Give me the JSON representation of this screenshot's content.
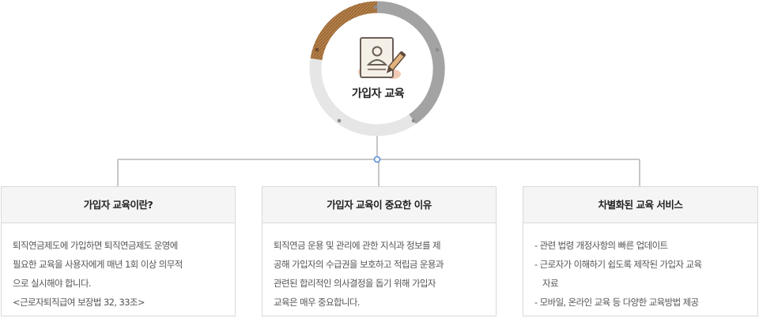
{
  "hub": {
    "label": "가입자 교육",
    "icon": "user-document-edit-icon",
    "ring_colors": {
      "track": "#e6e6e6",
      "shade": "#a3a3a3",
      "accent": "#b5804a",
      "dot": "#8c8c8c"
    }
  },
  "connector": {
    "color": "#c7c7c7",
    "node": "#5b8fd6"
  },
  "cards": [
    {
      "title": "가입자 교육이란?",
      "lines": [
        "퇴직연금제도에 가입하면 퇴직연금제도 운영에",
        "필요한 교육을 사용자에게 매년 1회 이상 의무적",
        "으로 실시해야 합니다.",
        "<근로자퇴직급여 보장법 32, 33조>"
      ]
    },
    {
      "title": "가입자 교육이 중요한 이유",
      "lines": [
        "퇴직연금 운용 및 관리에 관한 지식과 정보를 제",
        "공해 가입자의 수급권을 보호하고 적립금 운용과",
        "관련된 합리적인 의사결정을 돕기 위해 가입자",
        "교육은 매우 중요합니다."
      ]
    },
    {
      "title": "차별화된 교육 서비스",
      "items": [
        "관련 법령 개정사항의 빠른 업데이트",
        "근로자가 이해하기 쉽도록 제작된 가입자 교육자료",
        "모바일, 온라인 교육 등 다양한 교육방법 제공"
      ]
    }
  ]
}
